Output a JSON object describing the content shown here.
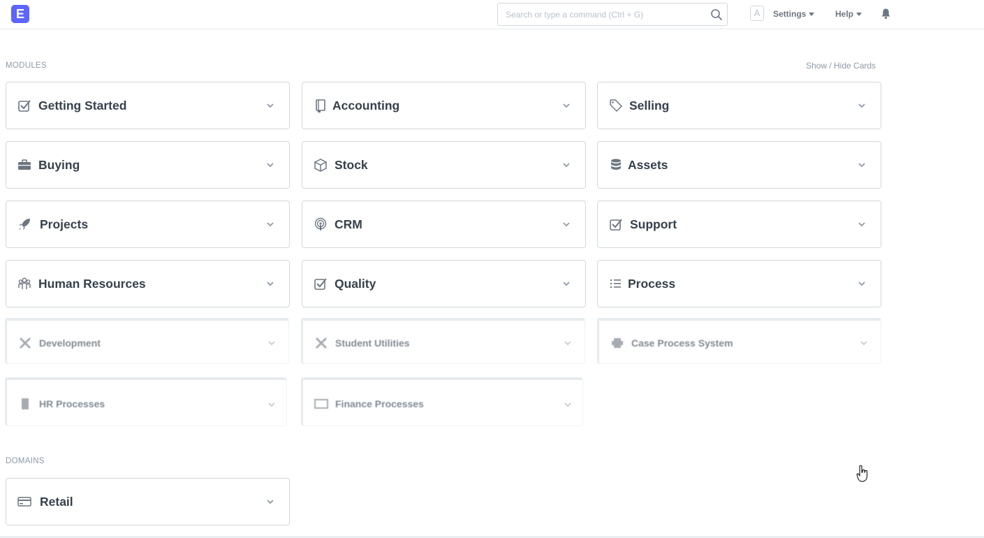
{
  "navbar": {
    "logo_letter": "E",
    "search_placeholder": "Search or type a command (Ctrl + G)",
    "avatar_letter": "A",
    "settings_label": "Settings",
    "help_label": "Help"
  },
  "modules": {
    "label": "MODULES",
    "show_hide_label": "Show / Hide Cards",
    "cards": [
      {
        "label": "Getting Started",
        "icon": "checkbox-icon"
      },
      {
        "label": "Accounting",
        "icon": "book-icon"
      },
      {
        "label": "Selling",
        "icon": "tag-icon"
      },
      {
        "label": "Buying",
        "icon": "briefcase-icon"
      },
      {
        "label": "Stock",
        "icon": "box-icon"
      },
      {
        "label": "Assets",
        "icon": "database-icon"
      },
      {
        "label": "Projects",
        "icon": "rocket-icon"
      },
      {
        "label": "CRM",
        "icon": "podcast-icon"
      },
      {
        "label": "Support",
        "icon": "checkbox-icon"
      },
      {
        "label": "Human Resources",
        "icon": "people-icon"
      },
      {
        "label": "Quality",
        "icon": "checkbox-icon"
      },
      {
        "label": "Process",
        "icon": "list-icon"
      },
      {
        "label": "Development",
        "icon": "tools-icon"
      },
      {
        "label": "Student Utilities",
        "icon": "tools-icon"
      },
      {
        "label": "Case Process System",
        "icon": "puzzle-icon"
      },
      {
        "label": "HR Processes",
        "icon": "database-icon"
      },
      {
        "label": "Finance Processes",
        "icon": "card-icon"
      }
    ]
  },
  "domains": {
    "label": "DOMAINS",
    "cards": [
      {
        "label": "Retail",
        "icon": "credit-card-icon"
      }
    ]
  },
  "colors": {
    "accent": "#5e64ff",
    "text": "#36414c",
    "muted": "#8d99a6",
    "border": "#d1d8dd"
  }
}
